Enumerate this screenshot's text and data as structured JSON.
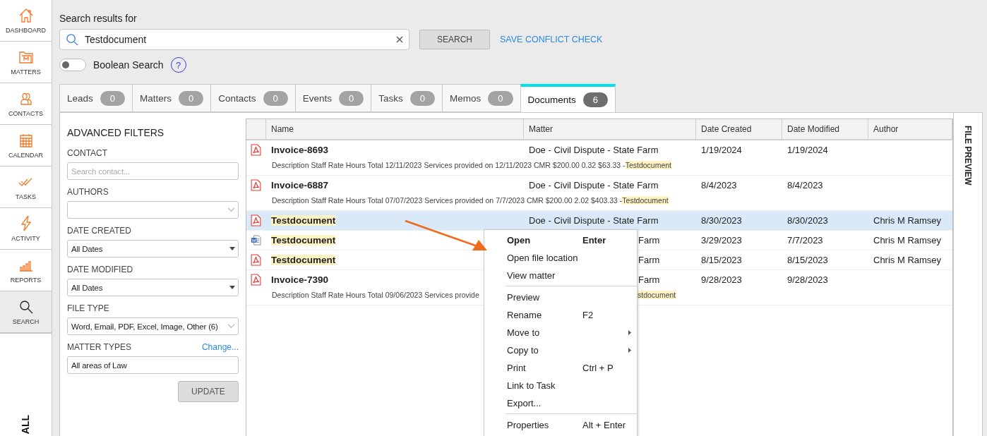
{
  "sidebar": {
    "items": [
      {
        "label": "DASHBOARD",
        "selected": false
      },
      {
        "label": "MATTERS",
        "selected": false
      },
      {
        "label": "CONTACTS",
        "selected": false
      },
      {
        "label": "CALENDAR",
        "selected": false
      },
      {
        "label": "TASKS",
        "selected": false
      },
      {
        "label": "ACTIVITY",
        "selected": false
      },
      {
        "label": "REPORTS",
        "selected": false
      },
      {
        "label": "SEARCH",
        "selected": true
      }
    ],
    "bottom_label": "ALL"
  },
  "search": {
    "heading": "Search results for",
    "value": "Testdocument",
    "button": "SEARCH",
    "link": "SAVE CONFLICT CHECK",
    "boolean_label": "Boolean Search",
    "boolean_on": false,
    "help": "?"
  },
  "tabs": [
    {
      "label": "Leads",
      "count": "0",
      "selected": false
    },
    {
      "label": "Matters",
      "count": "0",
      "selected": false
    },
    {
      "label": "Contacts",
      "count": "0",
      "selected": false
    },
    {
      "label": "Events",
      "count": "0",
      "selected": false
    },
    {
      "label": "Tasks",
      "count": "0",
      "selected": false
    },
    {
      "label": "Memos",
      "count": "0",
      "selected": false
    },
    {
      "label": "Documents",
      "count": "6",
      "selected": true
    }
  ],
  "filters": {
    "title": "ADVANCED FILTERS",
    "fields": [
      {
        "label": "CONTACT",
        "kind": "text",
        "placeholder": "Search contact..."
      },
      {
        "label": "AUTHORS",
        "kind": "combo"
      },
      {
        "label": "DATE CREATED",
        "kind": "select",
        "value": "All Dates"
      },
      {
        "label": "DATE MODIFIED",
        "kind": "select",
        "value": "All Dates"
      },
      {
        "label": "FILE TYPE",
        "kind": "combo",
        "value": "Word, Email, PDF, Excel, Image, Other (6)"
      },
      {
        "label": "MATTER TYPES",
        "kind": "text",
        "value": "All areas of Law",
        "link": "Change..."
      }
    ],
    "button": "UPDATE"
  },
  "table": {
    "columns": [
      "Name",
      "Matter",
      "Date Created",
      "Date Modified",
      "Author"
    ],
    "rows": [
      {
        "kind": "pdf",
        "name": "Invoice-8693",
        "name_highlight": false,
        "matter": "Doe - Civil Dispute - State Farm",
        "created": "1/19/2024",
        "modified": "1/19/2024",
        "selected": false,
        "description": "Description Staff Rate Hours Total 12/11/2023 Services provided on 12/11/2023 CMR $200.00 0.32 $63.33 - ",
        "match": "Testdocument"
      },
      {
        "kind": "pdf",
        "name": "Invoice-6887",
        "name_highlight": false,
        "matter": "Doe - Civil Dispute - State Farm",
        "created": "8/4/2023",
        "modified": "8/4/2023",
        "selected": false,
        "description": "Description Staff Rate Hours Total 07/07/2023 Services provided on 7/7/2023 CMR $200.00 2.02 $403.33 - ",
        "match": "Testdocument"
      },
      {
        "kind": "pdf",
        "name": "Testdocument",
        "name_highlight": true,
        "matter": "Doe - Civil Dispute - State Farm",
        "created": "8/30/2023",
        "modified": "8/30/2023",
        "author": "Chris M Ramsey",
        "selected": true
      },
      {
        "kind": "word",
        "name": "Testdocument",
        "name_highlight": true,
        "matter": "Farm",
        "covered": true,
        "created": "3/29/2023",
        "modified": "7/7/2023",
        "author": "Chris M Ramsey",
        "selected": false
      },
      {
        "kind": "pdf",
        "name": "Testdocument",
        "name_highlight": true,
        "matter": "Farm",
        "covered": true,
        "created": "8/15/2023",
        "modified": "8/15/2023",
        "author": "Chris M Ramsey",
        "selected": false
      },
      {
        "kind": "pdf",
        "name": "Invoice-7390",
        "name_highlight": false,
        "matter": "Farm",
        "covered": true,
        "created": "9/28/2023",
        "modified": "9/28/2023",
        "selected": false,
        "description": "Description Staff Rate Hours Total 09/06/2023 Services provide",
        "match": "stdocument"
      }
    ]
  },
  "preview_label": "FILE PREVIEW",
  "context_menu": [
    {
      "kind": "item",
      "label": "Open",
      "shortcut": "Enter",
      "bold": true
    },
    {
      "kind": "item",
      "label": "Open file location"
    },
    {
      "kind": "item",
      "label": "View matter"
    },
    {
      "kind": "separator"
    },
    {
      "kind": "item",
      "label": "Preview"
    },
    {
      "kind": "item",
      "label": "Rename",
      "shortcut": "F2"
    },
    {
      "kind": "item",
      "label": "Move to",
      "submenu": true
    },
    {
      "kind": "item",
      "label": "Copy to",
      "submenu": true
    },
    {
      "kind": "item",
      "label": "Print",
      "shortcut": "Ctrl + P"
    },
    {
      "kind": "item",
      "label": "Link to Task"
    },
    {
      "kind": "item",
      "label": "Export..."
    },
    {
      "kind": "separator"
    },
    {
      "kind": "item",
      "label": "Properties",
      "shortcut": "Alt + Enter"
    }
  ]
}
